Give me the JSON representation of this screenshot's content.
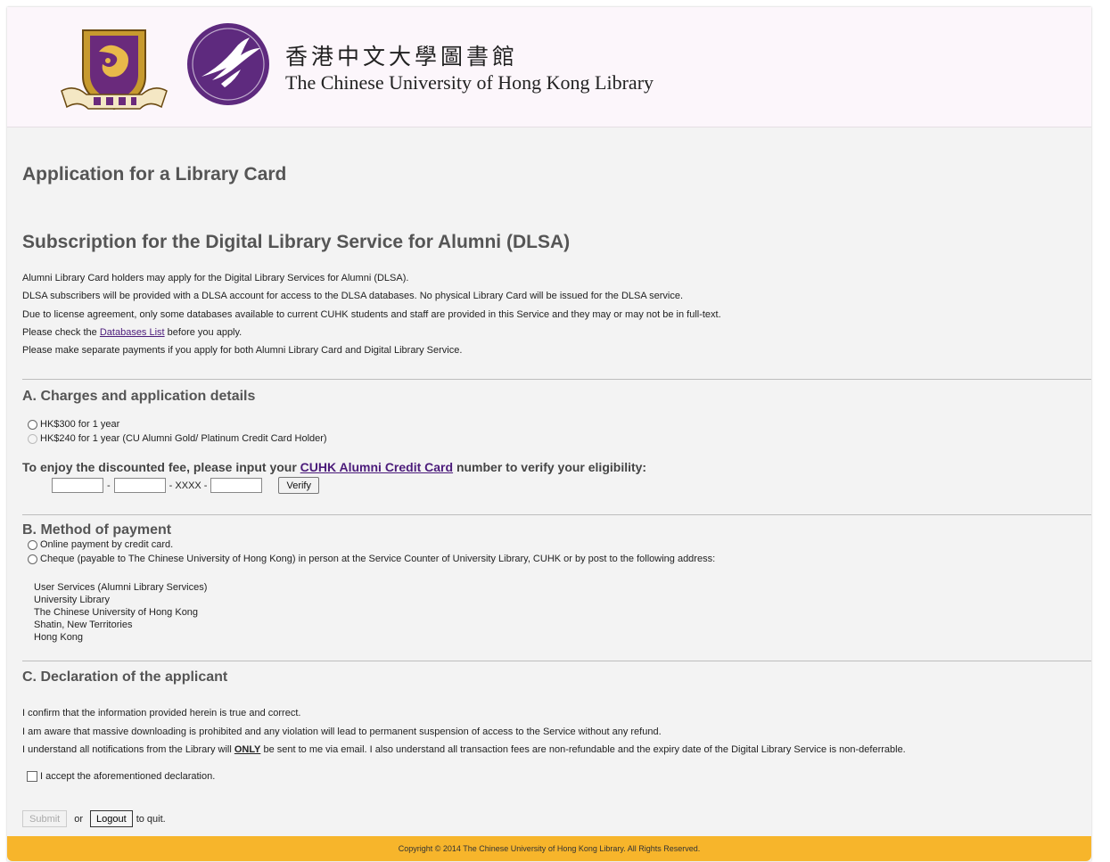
{
  "header": {
    "crest_icon": "cuhk-crest-icon",
    "logo_icon": "library-swallow-logo-icon",
    "chinese_name": "香港中文大學圖書館",
    "english_name": "The Chinese University of Hong Kong Library"
  },
  "page_title": "Application for a Library Card",
  "subtitle": "Subscription for the Digital Library Service for Alumni (DLSA)",
  "intro": {
    "line1": "Alumni Library Card holders may apply for the Digital Library Services for Alumni (DLSA).",
    "line2": "DLSA subscribers will be provided with a DLSA account for access to the DLSA databases. No physical Library Card will be issued for the DLSA service.",
    "line3": "Due to license agreement, only some databases available to current CUHK students and staff are provided in this Service and they may or may not be in full-text.",
    "line4_pre": "Please check the ",
    "line4_link": "Databases List",
    "line4_post": " before you apply.",
    "line5": "Please make separate payments if you apply for both Alumni Library Card and Digital Library Service."
  },
  "section_a": {
    "title": "A. Charges and application details",
    "options": [
      {
        "label": "HK$300 for 1 year",
        "disabled": false
      },
      {
        "label": "HK$240 for 1 year (CU Alumni Gold/ Platinum Credit Card Holder)",
        "disabled": true
      }
    ],
    "discount_pre": "To enjoy the discounted fee, please input your ",
    "discount_link": "CUHK Alumni Credit Card",
    "discount_post": " number to verify your eligibility:",
    "sep1": "-",
    "sep2": "- XXXX -",
    "verify_label": "Verify"
  },
  "section_b": {
    "title": "B. Method of payment",
    "options": [
      {
        "label": "Online payment by credit card."
      },
      {
        "label": "Cheque (payable to The Chinese University of Hong Kong) in person at the Service Counter of University Library, CUHK or by post to the following address:"
      }
    ],
    "address": [
      "User Services (Alumni Library Services)",
      "University Library",
      "The Chinese University of Hong Kong",
      "Shatin, New Territories",
      "Hong Kong"
    ]
  },
  "section_c": {
    "title": "C. Declaration of the applicant",
    "line1": "I confirm that the information provided herein is true and correct.",
    "line2": "I am aware that massive downloading is prohibited and any violation will lead to permanent suspension of access to the Service without any refund.",
    "line3_pre": "I understand all notifications from the Library will ",
    "line3_bold": "ONLY",
    "line3_post": " be sent to me via email. I also understand all transaction fees are non-refundable and the expiry date of the Digital Library Service is non-deferrable.",
    "accept_label": "I accept the aforementioned declaration."
  },
  "actions": {
    "submit_label": "Submit",
    "or_text": "or",
    "logout_label": "Logout",
    "quit_text": "to quit."
  },
  "footer": {
    "copyright": "Copyright © 2014 The Chinese University of Hong Kong Library. All Rights Reserved."
  },
  "colors": {
    "header_bg": "#fcf6fb",
    "page_bg": "#f3f3f3",
    "footer_bg": "#f7b52b",
    "brand_purple": "#5e2a7e",
    "link_purple": "#4b1b7a"
  }
}
